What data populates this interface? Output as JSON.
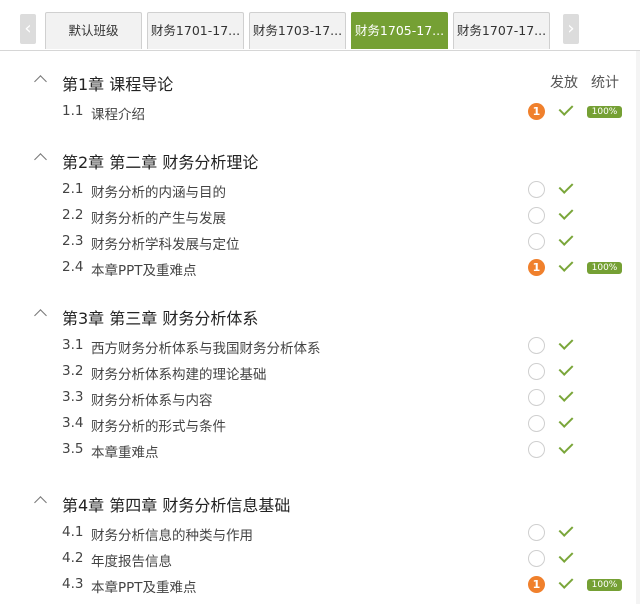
{
  "tabs": [
    {
      "label": "默认班级",
      "active": false
    },
    {
      "label": "财务1701-17...",
      "active": false
    },
    {
      "label": "财务1703-17...",
      "active": false
    },
    {
      "label": "财务1705-17...",
      "active": true
    },
    {
      "label": "财务1707-17...",
      "active": false
    }
  ],
  "nav": {
    "prev_icon": "‹",
    "next_icon": "›"
  },
  "columns": {
    "publish": "发放",
    "stats": "统计"
  },
  "colors": {
    "accent": "#75a034",
    "badge": "#f0802c",
    "check": "#7aa63a"
  },
  "chapters": [
    {
      "title": "第1章 课程导论",
      "sections": [
        {
          "num": "1.1",
          "title": "课程介绍",
          "count": "1",
          "percent": "100%"
        }
      ]
    },
    {
      "title": "第2章 第二章 财务分析理论",
      "sections": [
        {
          "num": "2.1",
          "title": "财务分析的内涵与目的"
        },
        {
          "num": "2.2",
          "title": "财务分析的产生与发展"
        },
        {
          "num": "2.3",
          "title": "财务分析学科发展与定位"
        },
        {
          "num": "2.4",
          "title": "本章PPT及重难点",
          "count": "1",
          "percent": "100%"
        }
      ]
    },
    {
      "title": "第3章 第三章 财务分析体系",
      "sections": [
        {
          "num": "3.1",
          "title": "西方财务分析体系与我国财务分析体系"
        },
        {
          "num": "3.2",
          "title": "财务分析体系构建的理论基础"
        },
        {
          "num": "3.3",
          "title": "财务分析体系与内容"
        },
        {
          "num": "3.4",
          "title": "财务分析的形式与条件"
        },
        {
          "num": "3.5",
          "title": "本章重难点"
        }
      ]
    },
    {
      "title": "第4章 第四章 财务分析信息基础",
      "sections": [
        {
          "num": "4.1",
          "title": "财务分析信息的种类与作用"
        },
        {
          "num": "4.2",
          "title": "年度报告信息"
        },
        {
          "num": "4.3",
          "title": "本章PPT及重难点",
          "count": "1",
          "percent": "100%"
        }
      ]
    }
  ]
}
